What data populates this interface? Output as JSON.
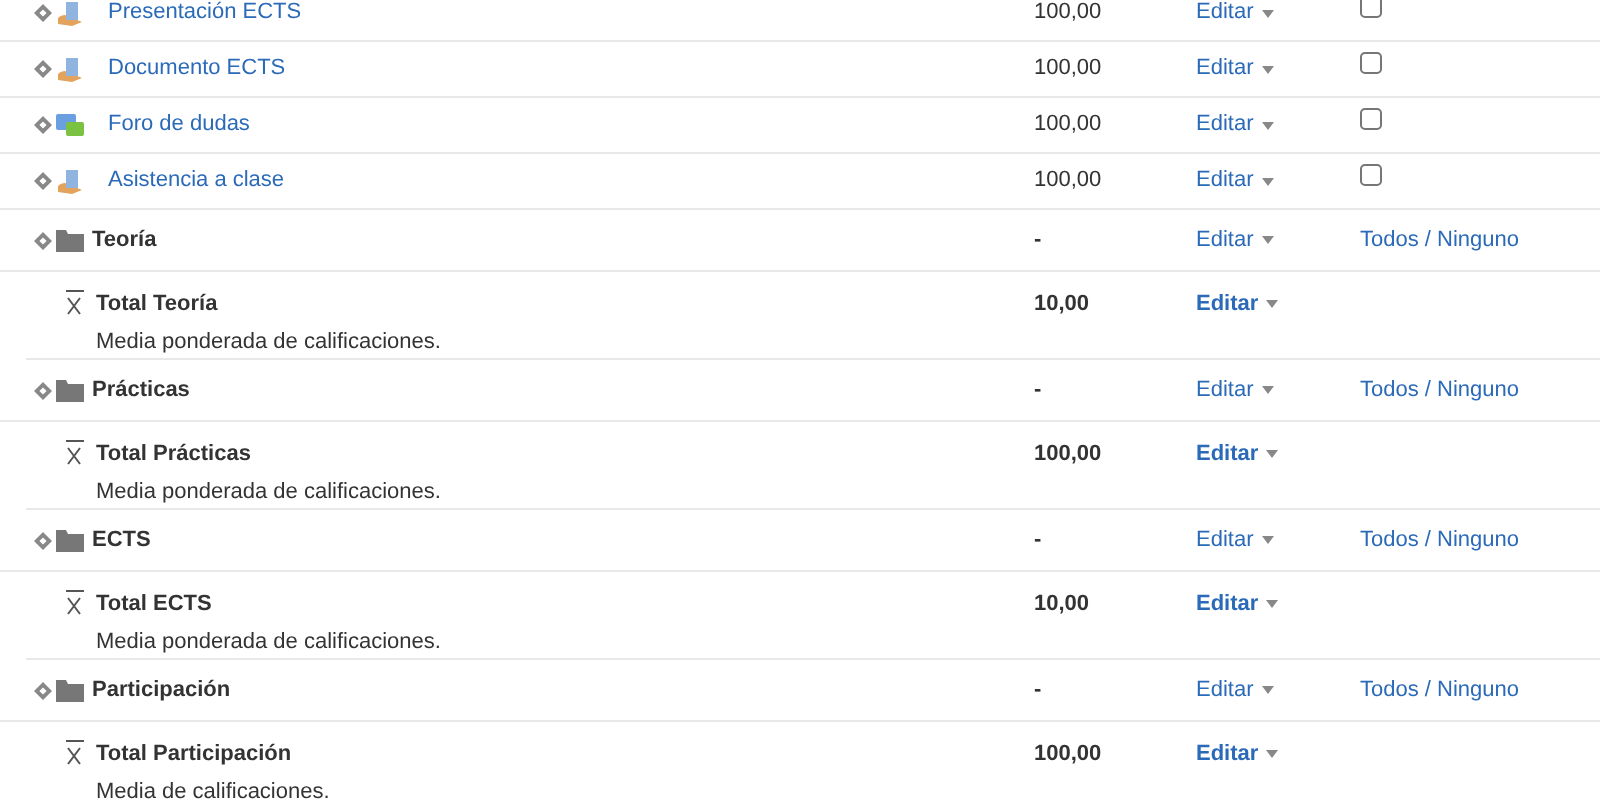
{
  "rows": [
    {
      "kind": "resource",
      "name": "Presentación ECTS",
      "value": "100,00",
      "action": "Editar",
      "checked": false
    },
    {
      "kind": "resource",
      "name": "Documento ECTS",
      "value": "100,00",
      "action": "Editar",
      "checked": false
    },
    {
      "kind": "forum",
      "name": "Foro de dudas",
      "value": "100,00",
      "action": "Editar",
      "checked": false
    },
    {
      "kind": "resource",
      "name": "Asistencia a clase",
      "value": "100,00",
      "action": "Editar",
      "checked": false
    },
    {
      "kind": "category",
      "name": "Teoría",
      "value": "-",
      "action": "Editar",
      "select": "Todos / Ninguno"
    },
    {
      "kind": "total",
      "name": "Total Teoría",
      "description": "Media ponderada de calificaciones.",
      "value": "10,00",
      "action": "Editar"
    },
    {
      "kind": "category",
      "name": "Prácticas",
      "value": "-",
      "action": "Editar",
      "select": "Todos / Ninguno"
    },
    {
      "kind": "total",
      "name": "Total Prácticas",
      "description": "Media ponderada de calificaciones.",
      "value": "100,00",
      "action": "Editar"
    },
    {
      "kind": "category",
      "name": "ECTS",
      "value": "-",
      "action": "Editar",
      "select": "Todos / Ninguno"
    },
    {
      "kind": "total",
      "name": "Total ECTS",
      "description": "Media ponderada de calificaciones.",
      "value": "10,00",
      "action": "Editar"
    },
    {
      "kind": "category",
      "name": "Participación",
      "value": "-",
      "action": "Editar",
      "select": "Todos / Ninguno"
    },
    {
      "kind": "total",
      "name": "Total Participación",
      "description": "Media de calificaciones.",
      "value": "100,00",
      "action": "Editar"
    }
  ]
}
